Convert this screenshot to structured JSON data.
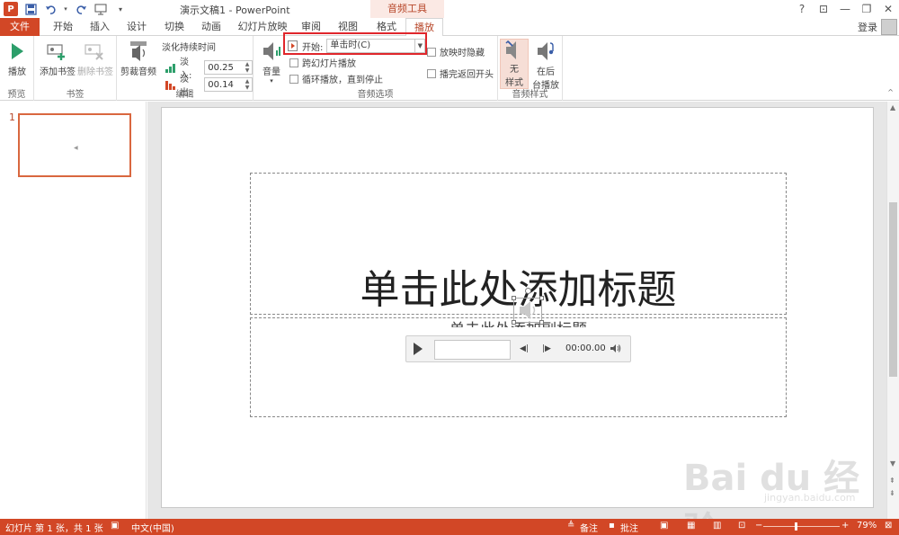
{
  "titlebar": {
    "window_title": "演示文稿1 - PowerPoint",
    "context_title": "音频工具",
    "logo_letter": "P",
    "help": "?",
    "ribbon_display": "⊡",
    "minimize": "—",
    "restore": "❐",
    "close": "✕"
  },
  "tabs": {
    "file": "文件",
    "home": "开始",
    "insert": "插入",
    "design": "设计",
    "transitions": "切换",
    "animations": "动画",
    "slideshow": "幻灯片放映",
    "review": "审阅",
    "view": "视图",
    "format": "格式",
    "playback": "播放",
    "login": "登录"
  },
  "ribbon": {
    "preview": {
      "play": "播放",
      "group": "预览"
    },
    "bookmarks": {
      "add": "添加书签",
      "remove": "删除书签",
      "group": "书签"
    },
    "editing": {
      "trim": "剪裁音频",
      "fade_title": "淡化持续时间",
      "fade_in_label": "淡入:",
      "fade_in_value": "00.25",
      "fade_out_label": "淡出:",
      "fade_out_value": "00.14",
      "group": "编辑"
    },
    "audio_options": {
      "volume": "音量",
      "start_label": "开始:",
      "start_value": "单击时(C)",
      "across_slides": "跨幻灯片播放",
      "loop": "循环播放，直到停止",
      "hide_during_show": "放映时隐藏",
      "rewind": "播完返回开头",
      "group": "音频选项"
    },
    "audio_styles": {
      "no_style": "无\n样式",
      "no_style_l1": "无",
      "no_style_l2": "样式",
      "bg_l1": "在后",
      "bg_l2": "台播放",
      "group": "音频样式"
    }
  },
  "thumbnails": {
    "slide_number": "1"
  },
  "slide": {
    "title_placeholder": "单击此处添加标题",
    "subtitle_placeholder": "单击此处添加副标题",
    "player_time": "00:00.00"
  },
  "statusbar": {
    "slide_info": "幻灯片 第 1 张，共 1 张",
    "language": "中文(中国)",
    "notes": "备注",
    "comments": "批注",
    "zoom": "79%"
  },
  "watermark": {
    "brand": "Bai du 经验",
    "url": "jingyan.baidu.com"
  },
  "colors": {
    "accent": "#d24726",
    "highlight": "#e0262b",
    "context_tab_bg": "#fbe9e4"
  }
}
